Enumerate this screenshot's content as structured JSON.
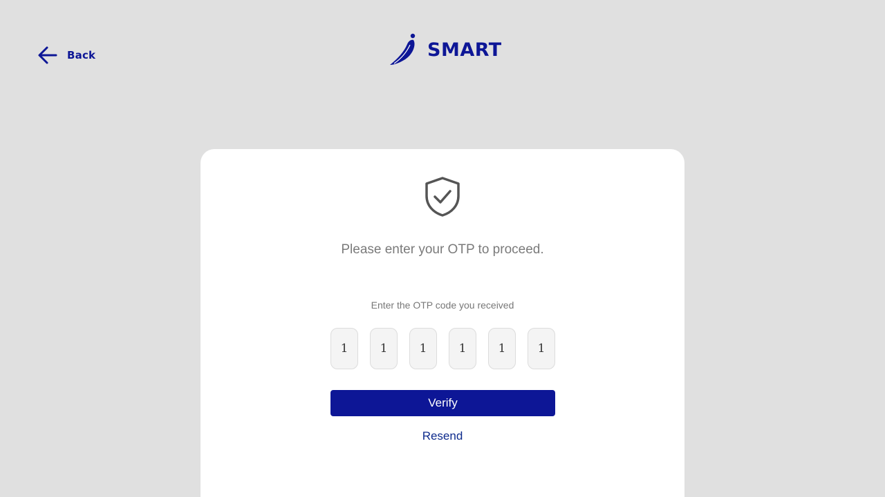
{
  "header": {
    "back_label": "Back",
    "brand_name": "SMART"
  },
  "card": {
    "prompt": "Please enter your OTP to proceed.",
    "otp_label": "Enter the OTP code you received",
    "otp_digits": [
      "1",
      "1",
      "1",
      "1",
      "1",
      "1"
    ],
    "verify_label": "Verify",
    "resend_label": "Resend"
  },
  "colors": {
    "brand": "#0d1696",
    "background": "#e0e0e0",
    "card": "#ffffff",
    "icon": "#555555"
  },
  "icons": {
    "back": "arrow-left-icon",
    "logo": "brand-logo-icon",
    "security": "shield-check-icon"
  }
}
